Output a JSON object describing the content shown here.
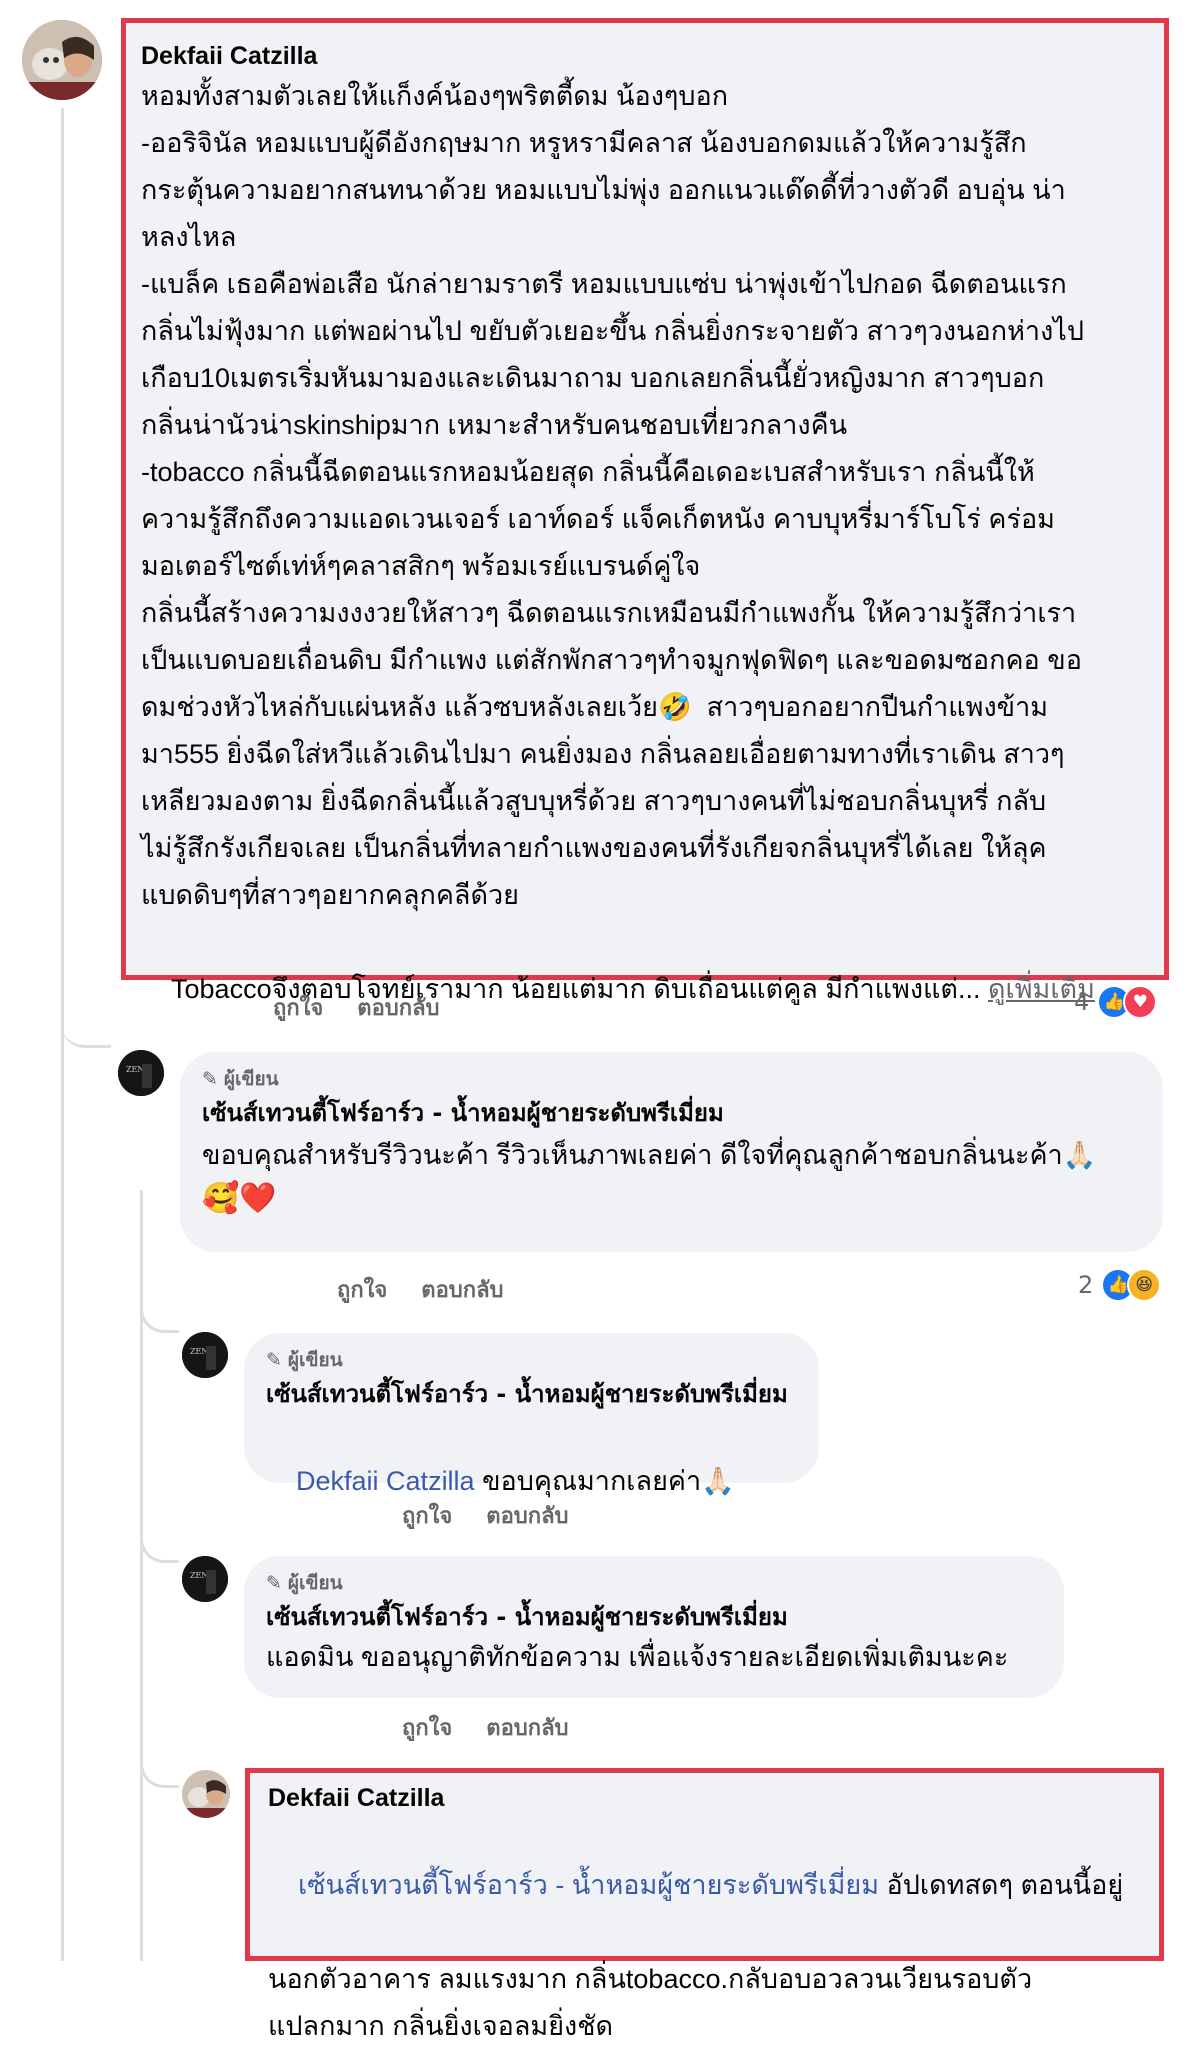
{
  "comment_main": {
    "name": "Dekfaii Catzilla",
    "lines": [
      "หอมทั้งสามตัวเลยให้แก็งค์น้องๆพริตตี้ดม น้องๆบอก",
      "-ออริจินัล หอมแบบผู้ดีอังกฤษมาก หรูหรามีคลาส น้องบอกดมแล้วให้ความรู้สึก",
      "กระตุ้นความอยากสนทนาด้วย หอมแบบไม่พุ่ง ออกแนวแด๊ดดี้ที่วางตัวดี อบอุ่น น่า",
      "หลงไหล",
      "-แบล็ค เธอคือพ่อเสือ นักล่ายามราตรี หอมแบบแซ่บ น่าพุ่งเข้าไปกอด ฉีดตอนแรก",
      "กลิ่นไม่ฟุ้งมาก แต่พอผ่านไป ขยับตัวเยอะขึ้น กลิ่นยิ่งกระจายตัว สาวๆวงนอกห่างไป",
      "เกือบ10เมตรเริ่มหันมามองและเดินมาถาม บอกเลยกลิ่นนี้ยั่วหญิงมาก สาวๆบอก",
      "กลิ่นน่านัวน่าskinshipมาก เหมาะสำหรับคนชอบเที่ยวกลางคืน",
      "-tobacco กลิ่นนี้ฉีดตอนแรกหอมน้อยสุด กลิ่นนี้คือเดอะเบสสำหรับเรา กลิ่นนี้ให้",
      "ความรู้สึกถึงความแอดเวนเจอร์ เอาท์ดอร์ แจ็คเก็ตหนัง คาบบุหรี่มาร์โบโร่ คร่อม",
      "มอเตอร์ไซต์เท่ห์ๆคลาสสิกๆ พร้อมเรย์แบรนด์คู่ใจ",
      "กลิ่นนี้สร้างความงงงวยให้สาวๆ ฉีดตอนแรกเหมือนมีกำแพงกั้น ให้ความรู้สึกว่าเรา",
      "เป็นแบดบอยเถื่อนดิบ มีกำแพง แต่สักพักสาวๆทำจมูกฟุดฟิดๆ และขอดมซอกคอ ขอ",
      "ดมช่วงหัวไหล่กับแผ่นหลัง แล้วซบหลังเลยเว้ย🤣  สาวๆบอกอยากปีนกำแพงข้าม",
      "มา555 ยิ่งฉีดใส่หวีแล้วเดินไปมา คนยิ่งมอง กลิ่นลอยเอื่อยตามทางที่เราเดิน สาวๆ",
      "เหลียวมองตาม ยิ่งฉีดกลิ่นนี้แล้วสูบบุหรี่ด้วย สาวๆบางคนที่ไม่ชอบกลิ่นบุหรี่ กลับ",
      "ไม่รู้สึกรังเกียจเลย เป็นกลิ่นที่ทลายกำแพงของคนที่รังเกียจกลิ่นบุหรี่ได้เลย ให้ลุค",
      "แบดดิบๆที่สาวๆอยากคลุกคลีด้วย"
    ],
    "last_line": "Tobaccoจึงตอบโจทย์เรามาก น้อยแต่มาก ดิบเถื่อนแต่คูล มีกำแพงแต่...",
    "see_more": "ดูเพิ่มเติม",
    "like": "ถูกใจ",
    "reply": "ตอบกลับ",
    "reaction_count": "4"
  },
  "reply1": {
    "author_badge": "ผู้เขียน",
    "page_name": "เซ้นส์เทวนตี้โฟร์อาร์ว - น้ำหอมผู้ชายระดับพรีเมี่ยม",
    "text": "ขอบคุณสำหรับรีวิวนะค้า รีวิวเห็นภาพเลยค่า ดีใจที่คุณลูกค้าชอบกลิ่นนะค้า🙏🏻",
    "emojis": "🥰❤️",
    "like": "ถูกใจ",
    "reply": "ตอบกลับ",
    "reaction_count": "2"
  },
  "reply2": {
    "author_badge": "ผู้เขียน",
    "page_name": "เซ้นส์เทวนตี้โฟร์อาร์ว - น้ำหอมผู้ชายระดับพรีเมี่ยม",
    "mention": "Dekfaii Catzilla",
    "text": " ขอบคุณมากเลยค่า🙏🏻",
    "like": "ถูกใจ",
    "reply": "ตอบกลับ"
  },
  "reply3": {
    "author_badge": "ผู้เขียน",
    "page_name": "เซ้นส์เทวนตี้โฟร์อาร์ว - น้ำหอมผู้ชายระดับพรีเมี่ยม",
    "text": "แอดมิน ขออนุญาติทักข้อความ เพื่อแจ้งรายละเอียดเพิ่มเติมนะคะ",
    "like": "ถูกใจ",
    "reply": "ตอบกลับ"
  },
  "reply4": {
    "name": "Dekfaii Catzilla",
    "mention": "เซ้นส์เทวนตี้โฟร์อาร์ว - น้ำหอมผู้ชายระดับพรีเมี่ยม",
    "text_first": " อัปเดทสดๆ ตอนนี้อยู่",
    "text_line2": "นอกตัวอาคาร ลมแรงมาก กลิ่นtobacco.กลับอบอวลวนเวียนรอบตัว",
    "text_line3": "แปลกมาก กลิ่นยิ่งเจอลมยิ่งชัด"
  },
  "colors": {
    "highlight": "#e0394b",
    "like_blue": "#1877f2",
    "love_red": "#f33e58",
    "bubble": "#f0f2f5"
  }
}
